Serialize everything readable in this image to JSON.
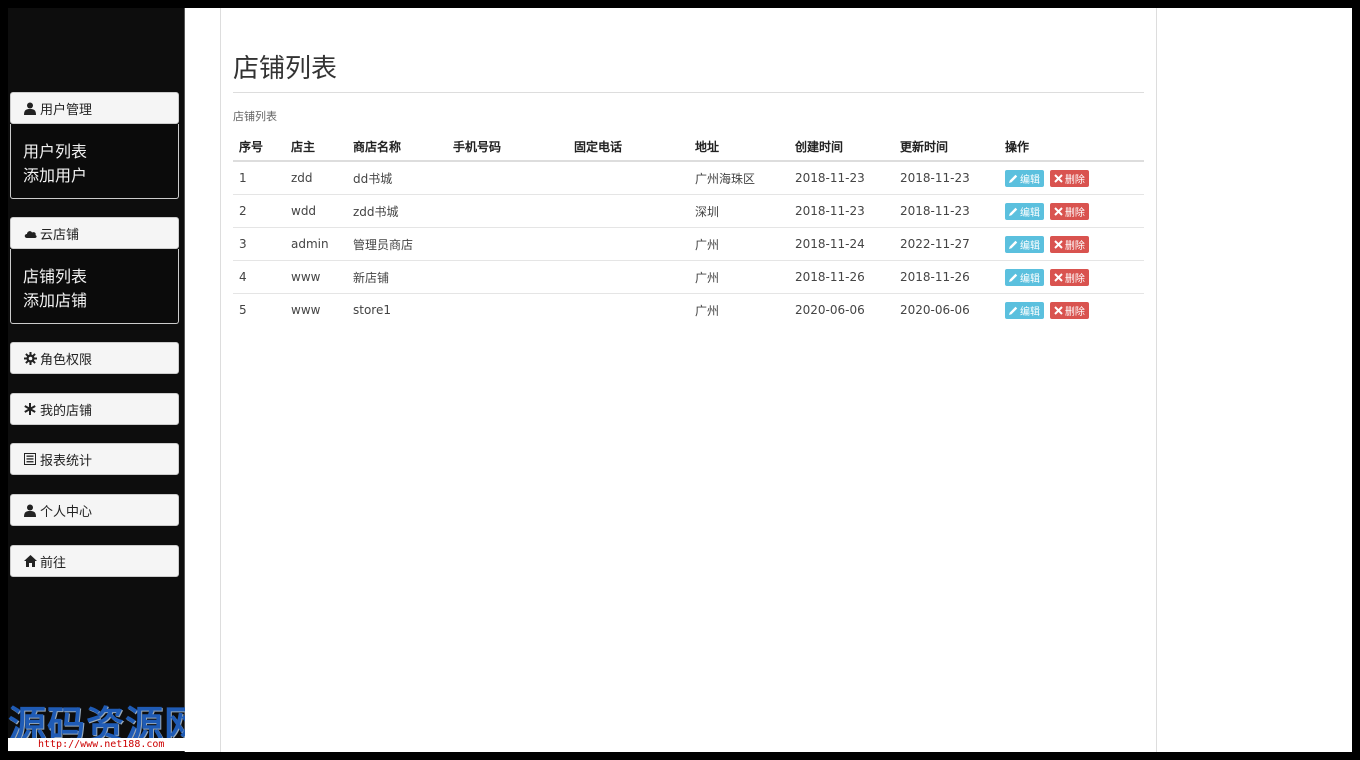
{
  "sidebar": {
    "groups": [
      {
        "title": "用户管理",
        "icon": "user-icon",
        "items": [
          "用户列表",
          "添加用户"
        ]
      },
      {
        "title": "云店铺",
        "icon": "cloud-icon",
        "items": [
          "店铺列表",
          "添加店铺"
        ]
      },
      {
        "title": "角色权限",
        "icon": "gear-icon"
      },
      {
        "title": "我的店铺",
        "icon": "asterisk-icon"
      },
      {
        "title": "报表统计",
        "icon": "list-alt-icon"
      },
      {
        "title": "个人中心",
        "icon": "user-icon"
      },
      {
        "title": "前往",
        "icon": "home-icon"
      }
    ]
  },
  "main": {
    "page_title": "店铺列表",
    "panel_label": "店铺列表",
    "table": {
      "columns": [
        "序号",
        "店主",
        "商店名称",
        "手机号码",
        "固定电话",
        "地址",
        "创建时间",
        "更新时间",
        "操作"
      ],
      "rows": [
        {
          "id": "1",
          "owner": "zdd",
          "name": "dd书城",
          "mobile": "",
          "phone": "",
          "address": "广州海珠区",
          "created": "2018-11-23",
          "updated": "2018-11-23"
        },
        {
          "id": "2",
          "owner": "wdd",
          "name": "zdd书城",
          "mobile": "",
          "phone": "",
          "address": "深圳",
          "created": "2018-11-23",
          "updated": "2018-11-23"
        },
        {
          "id": "3",
          "owner": "admin",
          "name": "管理员商店",
          "mobile": "",
          "phone": "",
          "address": "广州",
          "created": "2018-11-24",
          "updated": "2022-11-27"
        },
        {
          "id": "4",
          "owner": "www",
          "name": "新店铺",
          "mobile": "",
          "phone": "",
          "address": "广州",
          "created": "2018-11-26",
          "updated": "2018-11-26"
        },
        {
          "id": "5",
          "owner": "www",
          "name": "store1",
          "mobile": "",
          "phone": "",
          "address": "广州",
          "created": "2020-06-06",
          "updated": "2020-06-06"
        }
      ],
      "edit_label": "编辑",
      "delete_label": "删除"
    }
  },
  "watermark": {
    "text": "源码资源网",
    "url": "http://www.net188.com"
  },
  "colors": {
    "sidebar_bg": "#0d0d0d",
    "edit_btn": "#5bc0de",
    "delete_btn": "#d9534f",
    "watermark": "#1f5bb5"
  }
}
